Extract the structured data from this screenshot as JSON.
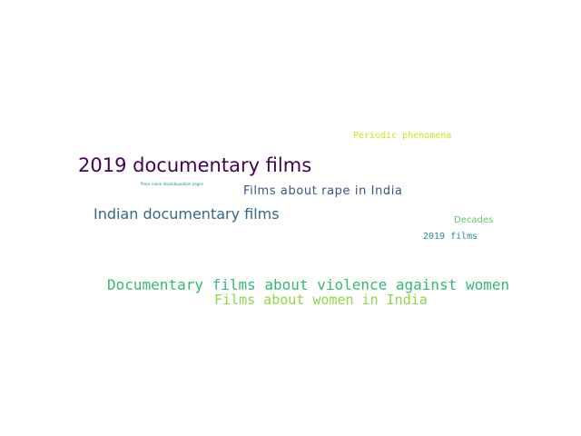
{
  "words": [
    {
      "text": "Periodic phenomena",
      "color": "#d2e21b"
    },
    {
      "text": "2019 documentary films",
      "color": "#440154"
    },
    {
      "text": "Place name disambiguation pages",
      "color": "#21918c"
    },
    {
      "text": "Films about rape in India",
      "color": "#3b528b"
    },
    {
      "text": "Indian documentary films",
      "color": "#31688e"
    },
    {
      "text": "Decades",
      "color": "#5ec962"
    },
    {
      "text": "2019 films",
      "color": "#21918c"
    },
    {
      "text": "Documentary films about violence against women",
      "color": "#35b779"
    },
    {
      "text": "Films about women in India",
      "color": "#90d743"
    }
  ]
}
